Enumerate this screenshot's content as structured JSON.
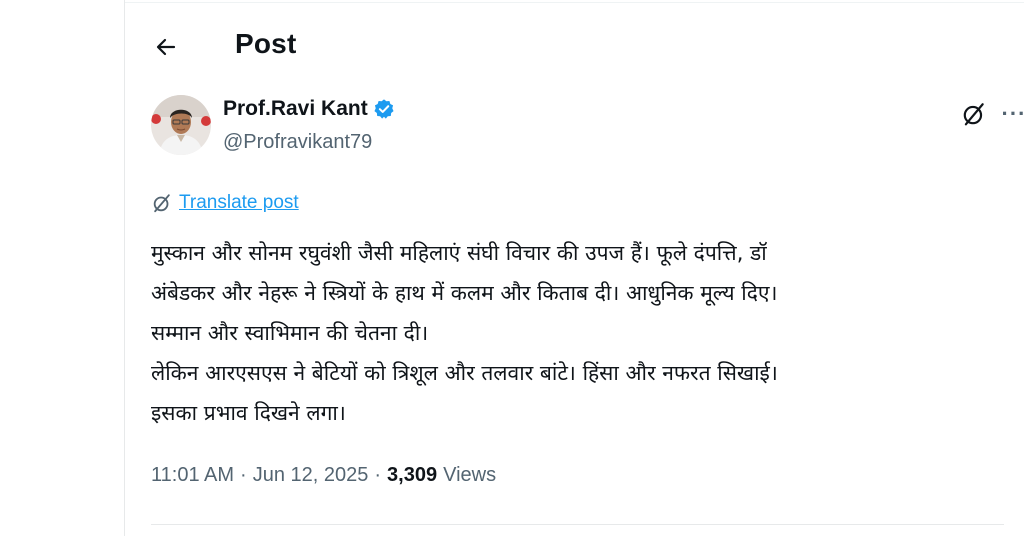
{
  "header": {
    "back_icon": "arrow-left-icon",
    "title": "Post"
  },
  "author": {
    "display_name": "Prof.Ravi Kant",
    "handle": "@Profravikant79",
    "verified": true,
    "verified_color": "#1d9bf0",
    "avatar": "profile-photo"
  },
  "actions": {
    "grok_icon": "grok-icon",
    "more_icon": "more-horizontal-icon",
    "more_label": "···"
  },
  "translate": {
    "icon": "grok-icon",
    "label": "Translate post"
  },
  "post": {
    "lines": [
      "मुस्कान और सोनम रघुवंशी जैसी महिलाएं संघी विचार की उपज हैं। फूले दंपत्ति, डॉ",
      "अंबेडकर और नेहरू ने स्त्रियों के हाथ में कलम और किताब दी। आधुनिक मूल्य दिए।",
      "सम्मान और स्वाभिमान की चेतना दी।",
      "लेकिन आरएसएस ने बेटियों को त्रिशूल और तलवार बांटे। हिंसा और नफरत सिखाई।",
      "इसका प्रभाव दिखने लगा।"
    ]
  },
  "meta": {
    "time": "11:01 AM",
    "separator": "·",
    "date": "Jun 12, 2025",
    "views_count": "3,309",
    "views_label": "Views"
  },
  "colors": {
    "text": "#0f1419",
    "secondary": "#536471",
    "link": "#1d9bf0",
    "border": "#e7e9ea"
  }
}
